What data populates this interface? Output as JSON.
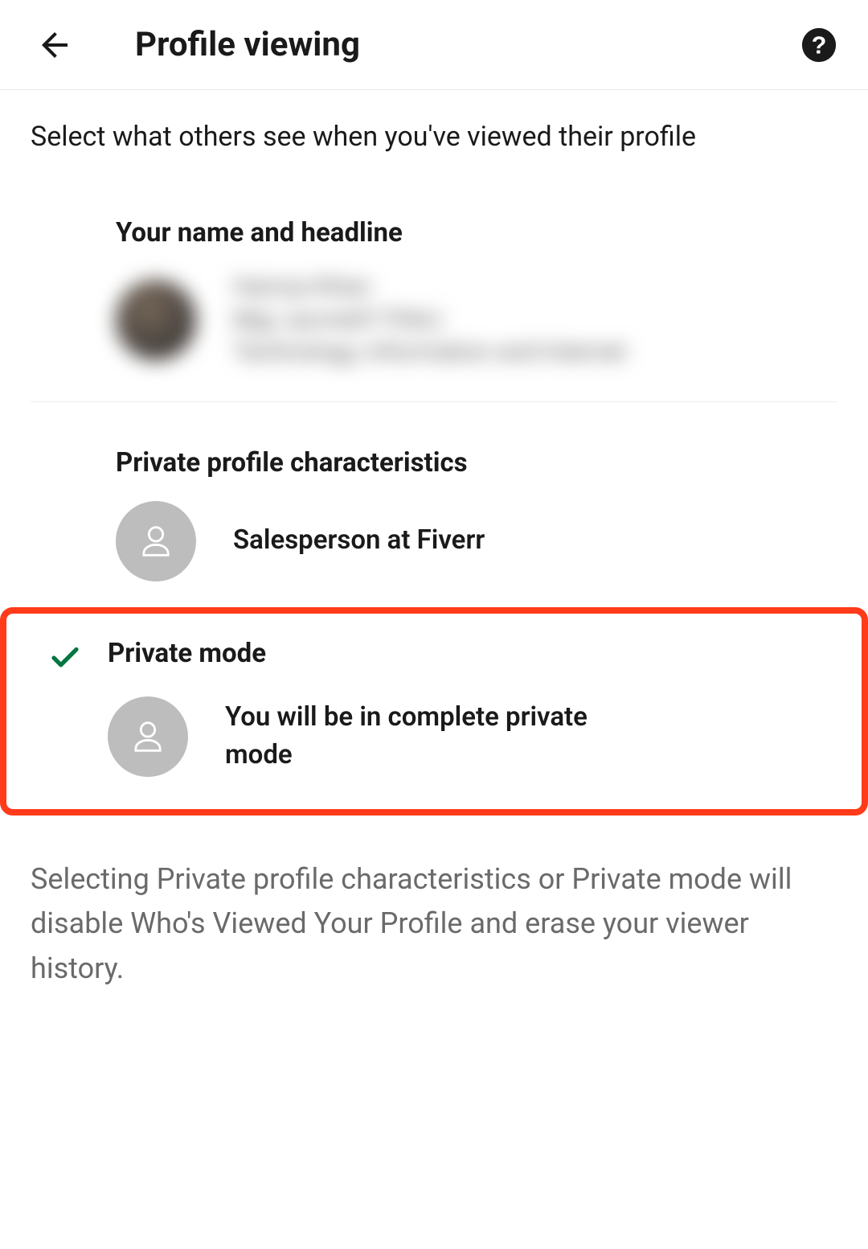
{
  "header": {
    "title": "Profile viewing"
  },
  "subtitle": "Select what others see when you've viewed their profile",
  "options": [
    {
      "heading": "Your name and headline",
      "description": "Hamza Khan\nMgr, (acme01754c)\nTechnology, Information and Internet",
      "selected": false
    },
    {
      "heading": "Private profile characteristics",
      "description": "Salesperson at Fiverr",
      "selected": false
    },
    {
      "heading": "Private mode",
      "description": "You will be in complete private mode",
      "selected": true
    }
  ],
  "footer_note": "Selecting Private profile characteristics or Private mode will disable Who's Viewed Your Profile and erase your viewer history."
}
